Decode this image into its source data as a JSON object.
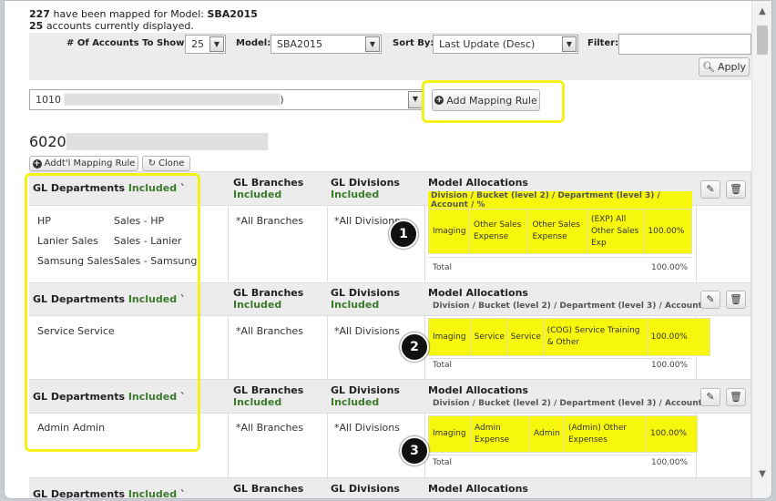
{
  "status": {
    "mapped_count": "227",
    "mapped_text": "have been mapped for Model:",
    "model_name": "SBA2015",
    "displayed_count": "25",
    "displayed_text": "accounts currently displayed."
  },
  "filters": {
    "accounts_label": "# Of Accounts To Show:",
    "accounts_value": "25",
    "model_label": "Model:",
    "model_value": "SBA2015",
    "sort_label": "Sort By:",
    "sort_value": "Last Update (Desc)",
    "filter_label": "Filter:",
    "filter_value": "",
    "apply_label": "Apply"
  },
  "account_select": {
    "value_prefix": "1010",
    "value_suffix": ")"
  },
  "add_mapping_rule_label": "Add Mapping Rule",
  "account_heading": "6020",
  "row_buttons": {
    "addl_label": "Addt'l Mapping Rule",
    "clone_label": "Clone"
  },
  "columns": {
    "dept": "GL Departments",
    "included": "Included",
    "branches": "GL Branches",
    "divisions": "GL Divisions",
    "model_alloc": "Model Allocations",
    "alloc_sub": "Division / Bucket (level 2) / Department (level 3) / Account / %",
    "total": "Total"
  },
  "rules": [
    {
      "departments": [
        [
          "HP",
          "Sales - HP"
        ],
        [
          "Lanier Sales",
          "Sales - Lanier"
        ],
        [
          "Samsung Sales",
          "Sales - Samsung"
        ]
      ],
      "branches": "*All Branches",
      "divisions": "*All Divisions",
      "allocation": [
        "Imaging",
        "Other Sales Expense",
        "Other Sales Expense",
        "(EXP) All Other Sales Exp",
        "100.00%"
      ],
      "total": "100.00%",
      "badge": "1"
    },
    {
      "departments": [
        [
          "Service",
          "Service"
        ]
      ],
      "branches": "*All Branches",
      "divisions": "*All Divisions",
      "allocation": [
        "Imaging",
        "Service",
        "Service",
        "(COG) Service Training & Other",
        "100.00%"
      ],
      "total": "100.00%",
      "badge": "2"
    },
    {
      "departments": [
        [
          "Admin",
          "Admin"
        ]
      ],
      "branches": "*All Branches",
      "divisions": "*All Divisions",
      "allocation": [
        "Imaging",
        "Admin Expense",
        "Admin",
        "(Admin) Other Expenses",
        "100.00%"
      ],
      "total": "100.00%",
      "badge": "3"
    }
  ],
  "colors": {
    "highlight": "#f2f21a",
    "included": "#3a7a2a"
  }
}
